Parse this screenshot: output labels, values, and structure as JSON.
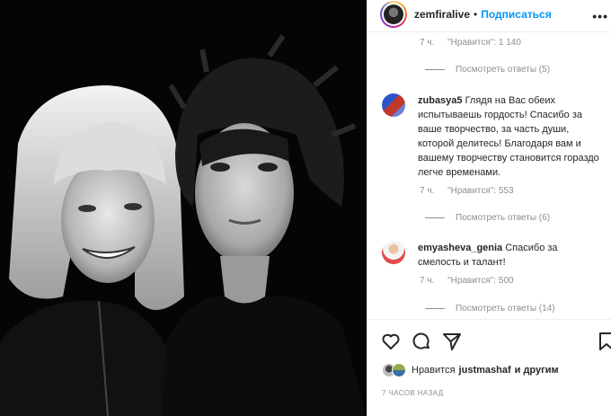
{
  "post": {
    "photo_alt": "black-and-white portrait photo"
  },
  "header": {
    "username": "zemfiralive",
    "separator": "•",
    "follow_label": "Подписаться",
    "more_icon": "more-horizontal-icon"
  },
  "thread_top": {
    "time": "7 ч.",
    "likes": "\"Нравится\": 1 140",
    "view_replies": "Посмотреть ответы (5)"
  },
  "comments": [
    {
      "username": "zubasya5",
      "text": "Глядя на Вас обеих испытываешь гордость! Спасибо за ваше творчество, за часть души, которой делитесь! Благодаря вам и вашему творчеству становится гораздо легче временами.",
      "time": "7 ч.",
      "likes": "\"Нравится\": 553",
      "view_replies": "Посмотреть ответы (6)"
    },
    {
      "username": "emyasheva_genia",
      "text": "Спасибо за смелость и талант!",
      "time": "7 ч.",
      "likes": "\"Нравится\": 500",
      "view_replies": "Посмотреть ответы (14)"
    }
  ],
  "actions": {
    "like_icon": "heart-icon",
    "comment_icon": "comment-icon",
    "share_icon": "share-icon",
    "save_icon": "bookmark-icon"
  },
  "likes_summary": {
    "prefix": "Нравится",
    "user": "justmashaf",
    "suffix": "и другим"
  },
  "timestamp": "7 ЧАСОВ НАЗАД"
}
